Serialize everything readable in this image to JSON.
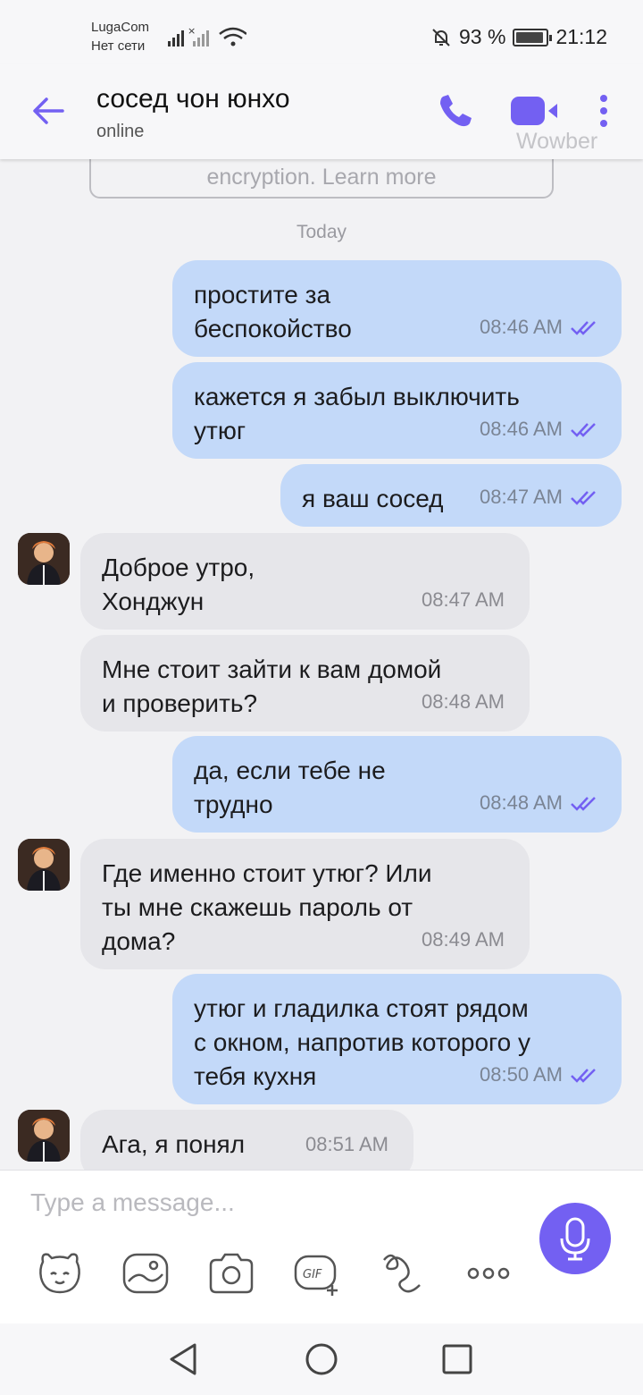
{
  "status_bar": {
    "carrier_name": "LugaCom",
    "carrier_status": "Нет сети",
    "battery_percent": "93 %",
    "battery_level": 0.93,
    "time": "21:12"
  },
  "header": {
    "contact_name": "сосед чон юнхо",
    "status": "online",
    "watermark": "Wowber",
    "icons": [
      "back-arrow-icon",
      "phone-icon",
      "video-camera-icon",
      "more-vertical-icon"
    ]
  },
  "chat": {
    "encryption_notice": "encryption. Learn more",
    "date_separator": "Today",
    "messages": [
      {
        "dir": "out",
        "text": "простите за\nбеспокойство",
        "time": "08:46 AM"
      },
      {
        "dir": "out",
        "text": "кажется я забыл выключить\nутюг",
        "time": "08:46 AM"
      },
      {
        "dir": "out",
        "text": "я ваш сосед",
        "time": "08:47 AM"
      },
      {
        "dir": "in",
        "text": "Доброе утро,\nХонджун",
        "time": "08:47 AM"
      },
      {
        "dir": "in",
        "text": "Мне стоит зайти к вам домой\nи проверить?",
        "time": "08:48 AM"
      },
      {
        "dir": "out",
        "text": "да, если тебе не\nтрудно",
        "time": "08:48 AM"
      },
      {
        "dir": "in",
        "text": "Где именно стоит утюг? Или\nты мне скажешь пароль от\nдома?",
        "time": "08:49 AM"
      },
      {
        "dir": "out",
        "text": "утюг и гладилка стоят рядом\nс окном, напротив которого у\nтебя кухня",
        "time": "08:50 AM"
      },
      {
        "dir": "in",
        "text": "Ага, я понял",
        "time": "08:51 AM"
      }
    ]
  },
  "composer": {
    "placeholder": "Type a message...",
    "tools": [
      "sticker-icon",
      "gallery-icon",
      "camera-icon",
      "gif-icon",
      "doodle-icon",
      "more-options-icon"
    ],
    "gif_label": "GIF"
  },
  "colors": {
    "accent": "#7360f2",
    "outgoing_bubble": "#c3d9f9",
    "incoming_bubble": "#e6e6ea"
  }
}
